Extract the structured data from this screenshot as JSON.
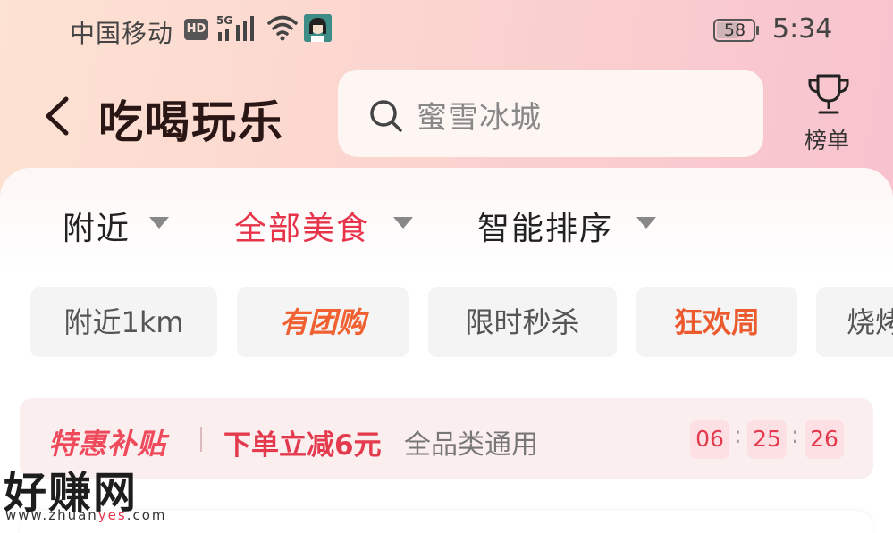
{
  "status_bar": {
    "carrier": "中国移动",
    "hd": "HD",
    "network": "5G",
    "battery": "58",
    "time": "5:34"
  },
  "header": {
    "title": "吃喝玩乐",
    "search_placeholder": "蜜雪冰城",
    "ranking_label": "榜单"
  },
  "filters": [
    {
      "label": "附近"
    },
    {
      "label": "全部美食"
    },
    {
      "label": "智能排序"
    }
  ],
  "chips": [
    {
      "label": "附近1km"
    },
    {
      "label": "有团购"
    },
    {
      "label": "限时秒杀"
    },
    {
      "label": "狂欢周"
    },
    {
      "label": "烧烤"
    }
  ],
  "banner": {
    "tag": "特惠补贴",
    "offer": "下单立减6元",
    "desc": "全品类通用",
    "countdown": {
      "hours": "06",
      "minutes": "25",
      "seconds": "26"
    },
    "separator": ":"
  },
  "watermark": {
    "main": "好赚网",
    "url_prefix": "www.zhuan",
    "url_highlight": "yes",
    "url_suffix": ".com"
  },
  "colors": {
    "accent": "#e8344a",
    "promo": "#f06030"
  }
}
